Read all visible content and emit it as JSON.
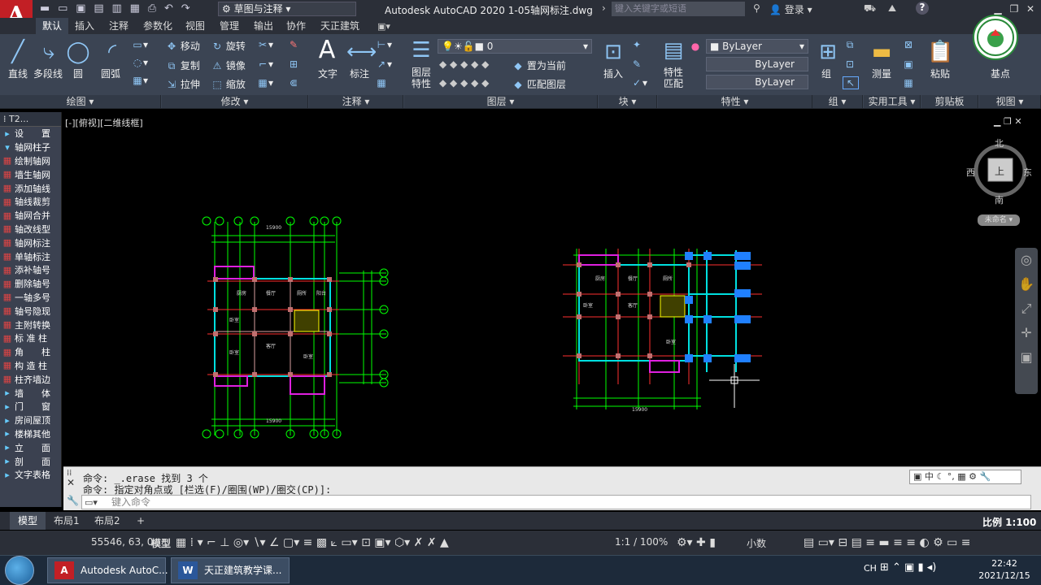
{
  "titlebar": {
    "workspace": "草图与注释",
    "app_title": "Autodesk AutoCAD 2020   1-05轴网标注.dwg",
    "search_placeholder": "键入关键字或短语",
    "login": "登录",
    "help": "?"
  },
  "ribbon_tabs": [
    "默认",
    "插入",
    "注释",
    "参数化",
    "视图",
    "管理",
    "输出",
    "协作",
    "天正建筑"
  ],
  "draw_panel": {
    "tools": [
      "直线",
      "多段线",
      "圆",
      "圆弧"
    ],
    "title": "绘图 ▾"
  },
  "modify_panel": {
    "row1": [
      "移动",
      "旋转"
    ],
    "row2": [
      "复制",
      "镜像"
    ],
    "row3": [
      "拉伸",
      "缩放"
    ],
    "title": "修改 ▾"
  },
  "annotate_panel": {
    "tools": [
      "文字",
      "标注"
    ],
    "title": "注释 ▾"
  },
  "layer_panel": {
    "big": "图层\n特性",
    "layer_value": "0",
    "set_current": "置为当前",
    "match": "匹配图层",
    "title": "图层 ▾"
  },
  "block_panel": {
    "big": "插入",
    "title": "块 ▾"
  },
  "properties_panel": {
    "big": "特性\n匹配",
    "bylayer1": "ByLayer",
    "bylayer2": "ByLayer",
    "bylayer3": "ByLayer",
    "title": "特性 ▾"
  },
  "group_panel": {
    "big": "组",
    "title": "组 ▾"
  },
  "utilities_panel": {
    "big": "测量",
    "title": "实用工具 ▾"
  },
  "clipboard_panel": {
    "big": "粘贴",
    "title": "剪贴板"
  },
  "view_panel": {
    "big": "基点",
    "title": "视图 ▾"
  },
  "palette": {
    "header": "T2...",
    "items": [
      {
        "label": "设　　置",
        "type": "cat"
      },
      {
        "label": "轴网柱子",
        "type": "cat"
      },
      {
        "label": "绘制轴网",
        "type": "sub"
      },
      {
        "label": "墙生轴网",
        "type": "sub"
      },
      {
        "label": "添加轴线",
        "type": "sub"
      },
      {
        "label": "轴线裁剪",
        "type": "sub"
      },
      {
        "label": "轴网合并",
        "type": "sub"
      },
      {
        "label": "轴改线型",
        "type": "sub"
      },
      {
        "label": "轴网标注",
        "type": "sub"
      },
      {
        "label": "单轴标注",
        "type": "sub"
      },
      {
        "label": "添补轴号",
        "type": "sub"
      },
      {
        "label": "删除轴号",
        "type": "sub"
      },
      {
        "label": "一轴多号",
        "type": "sub"
      },
      {
        "label": "轴号隐现",
        "type": "sub"
      },
      {
        "label": "主附转换",
        "type": "sub"
      },
      {
        "label": "标 准 柱",
        "type": "sub"
      },
      {
        "label": "角　　柱",
        "type": "sub"
      },
      {
        "label": "构 造 柱",
        "type": "sub"
      },
      {
        "label": "柱齐墙边",
        "type": "sub"
      },
      {
        "label": "墙　　体",
        "type": "cat"
      },
      {
        "label": "门　　窗",
        "type": "cat"
      },
      {
        "label": "房间屋顶",
        "type": "cat"
      },
      {
        "label": "楼梯其他",
        "type": "cat"
      },
      {
        "label": "立　　面",
        "type": "cat"
      },
      {
        "label": "剖　　面",
        "type": "cat"
      },
      {
        "label": "文字表格",
        "type": "cat"
      }
    ]
  },
  "viewport": {
    "label": "[-][俯视][二维线框]",
    "compass": {
      "n": "北",
      "s": "南",
      "e": "东",
      "w": "西",
      "face": "上"
    },
    "wcs": "未命名 ▾"
  },
  "plan_left": {
    "axis_top": [
      "1",
      "2",
      "1/3",
      "3",
      "4",
      "1/5",
      "5",
      "6"
    ],
    "axis_right": [
      "F",
      "E",
      "D",
      "C",
      "B",
      "A"
    ],
    "dims_top": [
      "900",
      "2400",
      "1500",
      "1800",
      "2340",
      "1450",
      "900"
    ],
    "total": "15900",
    "rooms": [
      "厨房",
      "餐厅",
      "厕所",
      "阳台",
      "卧室",
      "客厅",
      "卧室"
    ]
  },
  "plan_right": {
    "rooms": [
      "厨房",
      "餐厅",
      "厕所",
      "卧室",
      "客厅",
      "卧室"
    ],
    "total": "15900"
  },
  "command": {
    "line1": "命令: _.erase 找到 3 个",
    "line2": "命令: 指定对角点或 [栏选(F)/圈围(WP)/圈交(CP)]:",
    "placeholder": "键入命令"
  },
  "layout_tabs": [
    "模型",
    "布局1",
    "布局2",
    "+"
  ],
  "scale": "比例 1:100 ▾",
  "status": {
    "coords": "55546, 63, 0",
    "model": "模型",
    "annoscale": "1:1 / 100%",
    "units": "小数"
  },
  "taskbar": {
    "items": [
      "Autodesk AutoC...",
      "天正建筑教学课..."
    ],
    "time": "22:42",
    "date": "2021/12/15",
    "ime": "CH"
  },
  "colors": {
    "accent": "#c21f25",
    "ribbon": "#3b4453",
    "grid_green": "#00ff00",
    "wall_red": "#ff3030",
    "cyan": "#00e0e0",
    "magenta": "#e020e0",
    "blue": "#2080ff"
  }
}
